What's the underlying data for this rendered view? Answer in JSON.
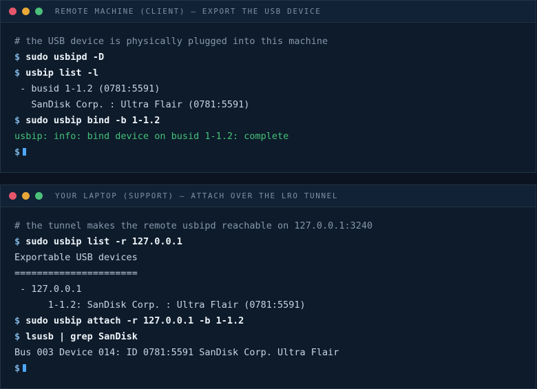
{
  "top_window": {
    "title": "REMOTE MACHINE (CLIENT) — EXPORT THE USB DEVICE",
    "comment": "# the USB device is physically plugged into this machine",
    "prompt": "$",
    "cmd1": "sudo usbipd -D",
    "cmd2": "usbip list -l",
    "out1": " - busid 1-1.2 (0781:5591)",
    "out2": "   SanDisk Corp. : Ultra Flair (0781:5591)",
    "cmd3": "sudo usbip bind -b 1-1.2",
    "success": "usbip: info: bind device on busid 1-1.2: complete"
  },
  "bottom_window": {
    "title": "YOUR LAPTOP (SUPPORT) — ATTACH OVER THE LRO TUNNEL",
    "comment": "# the tunnel makes the remote usbipd reachable on 127.0.0.1:3240",
    "prompt": "$",
    "cmd1": "sudo usbip list -r 127.0.0.1",
    "out1": "Exportable USB devices",
    "out2": "======================",
    "out3": " - 127.0.0.1",
    "out4": "      1-1.2: SanDisk Corp. : Ultra Flair (0781:5591)",
    "cmd2": "sudo usbip attach -r 127.0.0.1 -b 1-1.2",
    "cmd3": "lsusb | grep SanDisk",
    "out5": "Bus 003 Device 014: ID 0781:5591 SanDisk Corp. Ultra Flair"
  }
}
